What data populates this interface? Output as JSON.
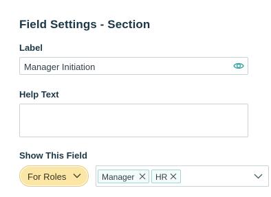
{
  "panel": {
    "title": "Field Settings - Section"
  },
  "label_field": {
    "label": "Label",
    "value": "Manager Initiation",
    "icon": "eye-icon"
  },
  "help_text_field": {
    "label": "Help Text",
    "value": ""
  },
  "show_field": {
    "label": "Show This Field",
    "mode_selected": "For Roles",
    "roles": [
      "Manager",
      "HR"
    ]
  },
  "colors": {
    "title": "#1b3646",
    "pill_background": "#fbe6a6",
    "tag_border": "#9fd5d5",
    "accent_teal": "#3aa6a6"
  }
}
